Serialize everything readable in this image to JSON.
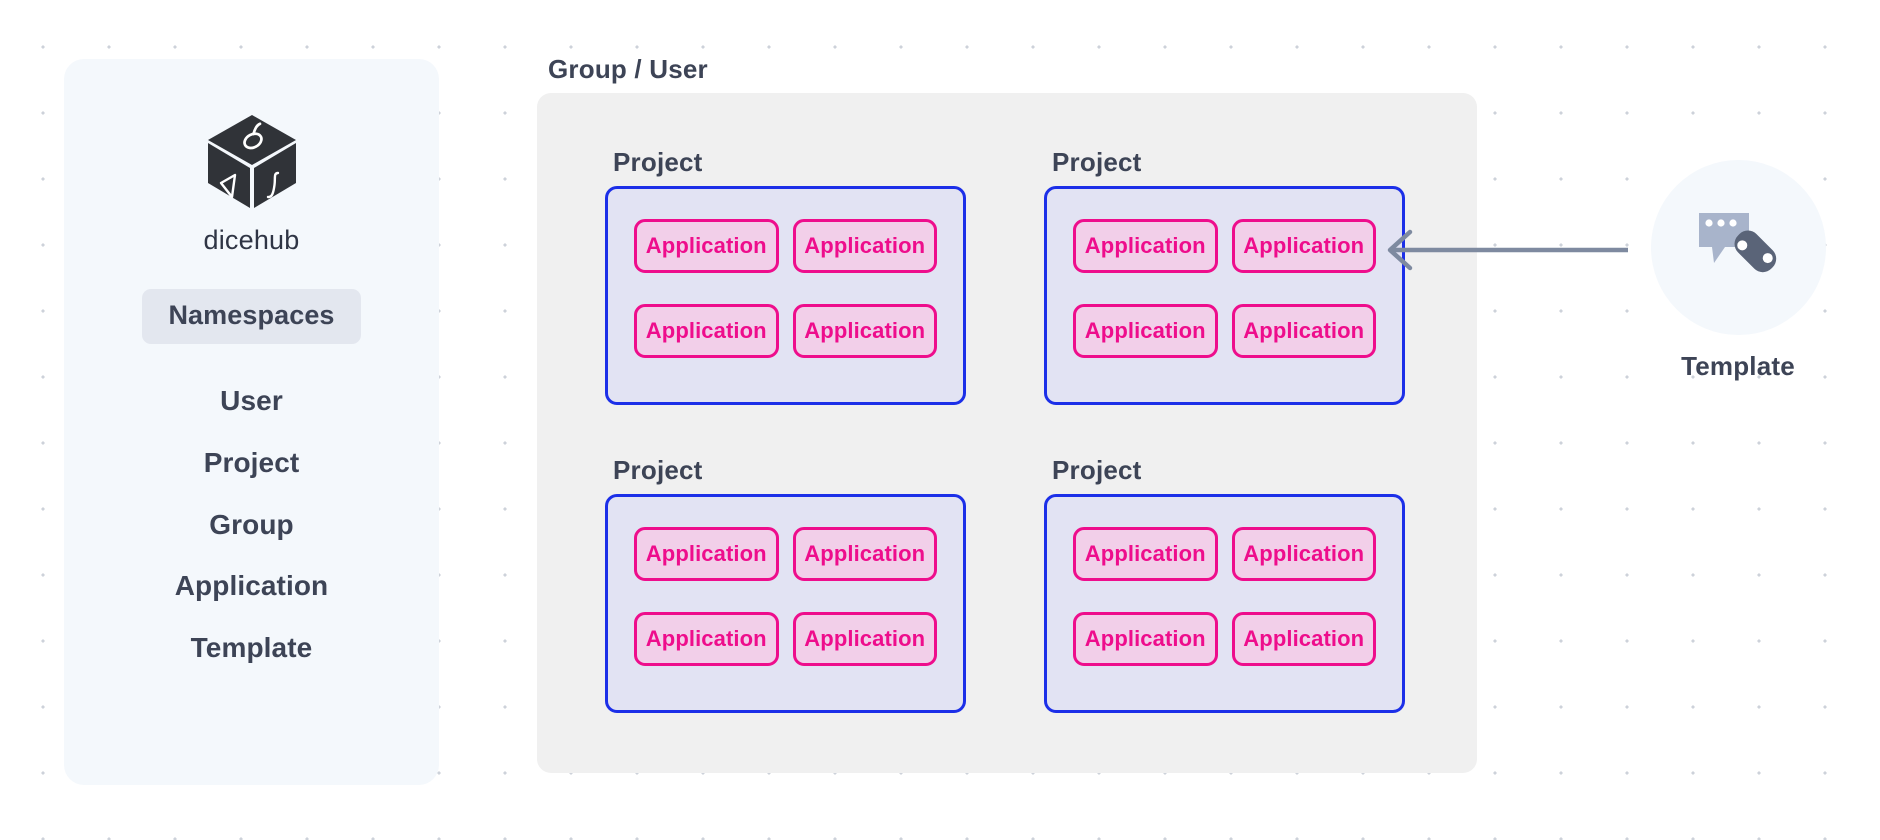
{
  "sidebar": {
    "brand_name": "dicehub",
    "logo_icon": "dicehub-cube-logo",
    "section_pill": "Namespaces",
    "items": [
      {
        "label": "User"
      },
      {
        "label": "Project"
      },
      {
        "label": "Group"
      },
      {
        "label": "Application"
      },
      {
        "label": "Template"
      }
    ]
  },
  "diagram": {
    "container_label": "Group / User",
    "projects": [
      {
        "label": "Project",
        "applications": [
          {
            "label": "Application"
          },
          {
            "label": "Application"
          },
          {
            "label": "Application"
          },
          {
            "label": "Application"
          }
        ]
      },
      {
        "label": "Project",
        "applications": [
          {
            "label": "Application"
          },
          {
            "label": "Application"
          },
          {
            "label": "Application"
          },
          {
            "label": "Application"
          }
        ]
      },
      {
        "label": "Project",
        "applications": [
          {
            "label": "Application"
          },
          {
            "label": "Application"
          },
          {
            "label": "Application"
          },
          {
            "label": "Application"
          }
        ]
      },
      {
        "label": "Project",
        "applications": [
          {
            "label": "Application"
          },
          {
            "label": "Application"
          },
          {
            "label": "Application"
          },
          {
            "label": "Application"
          }
        ]
      }
    ],
    "connector": {
      "icon": "arrow-left-icon",
      "direction": "points-left-to-application"
    },
    "template_node": {
      "label": "Template",
      "icon": "template-tag-pencil-icon"
    }
  },
  "colors": {
    "page_background": "#ffffff",
    "dot_grid": "#cdd2da",
    "panel_background": "#f4f8fc",
    "container_background": "#f0f0f0",
    "pill_background": "#e3e7ef",
    "text_dark": "#3d4456",
    "project_border": "#1c2fe8",
    "project_fill": "#e2e3f3",
    "application_border": "#ee0d8c",
    "application_fill": "#f2cfe9",
    "connector_line": "#7e8aa0",
    "template_icon_bubble": "#a8b4cb",
    "template_icon_pencil": "#5a6478"
  }
}
